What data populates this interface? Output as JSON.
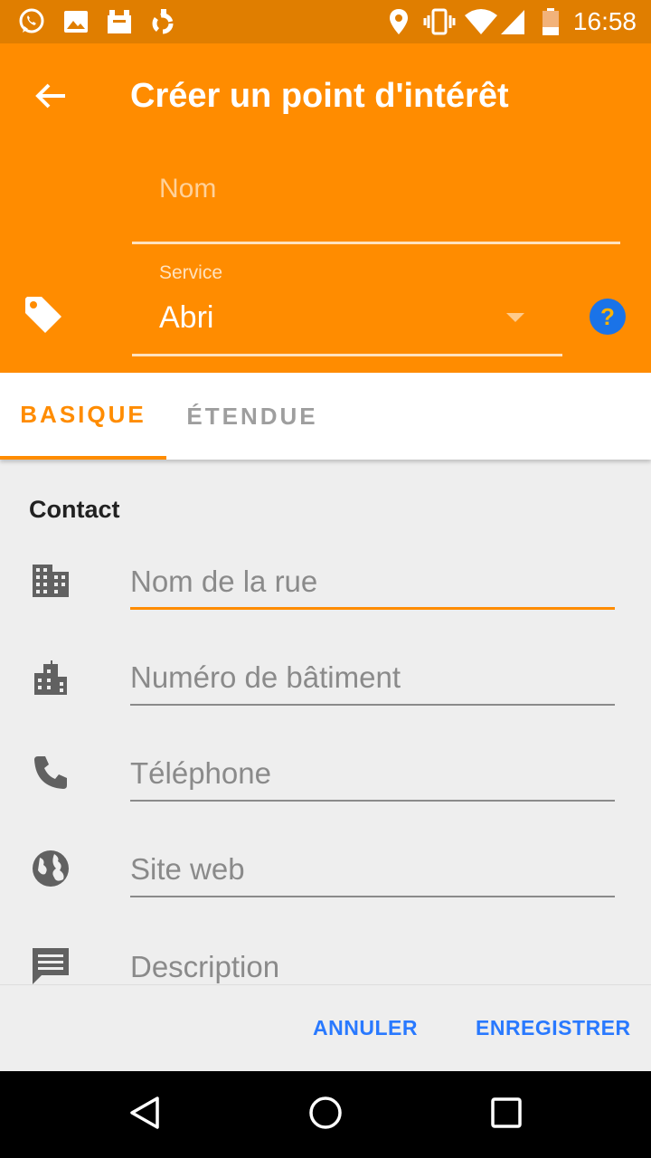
{
  "status_bar": {
    "time": "16:58",
    "left_icons": [
      "whatsapp-icon",
      "image-icon",
      "app-icon",
      "sync-icon"
    ],
    "right_icons": [
      "location-icon",
      "vibrate-icon",
      "wifi-icon",
      "signal-icon",
      "battery-icon"
    ]
  },
  "app_bar": {
    "title": "Créer un point d'intérêt",
    "name_placeholder": "Nom",
    "service_label": "Service",
    "service_value": "Abri",
    "help_symbol": "?"
  },
  "tabs": [
    {
      "label": "BASIQUE",
      "active": true
    },
    {
      "label": "ÉTENDUE",
      "active": false
    }
  ],
  "contact": {
    "section_title": "Contact",
    "fields": [
      {
        "placeholder": "Nom de la rue",
        "icon": "building-icon"
      },
      {
        "placeholder": "Numéro de bâtiment",
        "icon": "city-icon"
      },
      {
        "placeholder": "Téléphone",
        "icon": "phone-icon"
      },
      {
        "placeholder": "Site web",
        "icon": "globe-icon"
      },
      {
        "placeholder": "Description",
        "icon": "comment-icon"
      }
    ]
  },
  "actions": {
    "cancel": "ANNULER",
    "save": "ENREGISTRER"
  },
  "colors": {
    "primary": "#ff8c00",
    "status_bar": "#e07e00",
    "accent": "#2979ff"
  }
}
